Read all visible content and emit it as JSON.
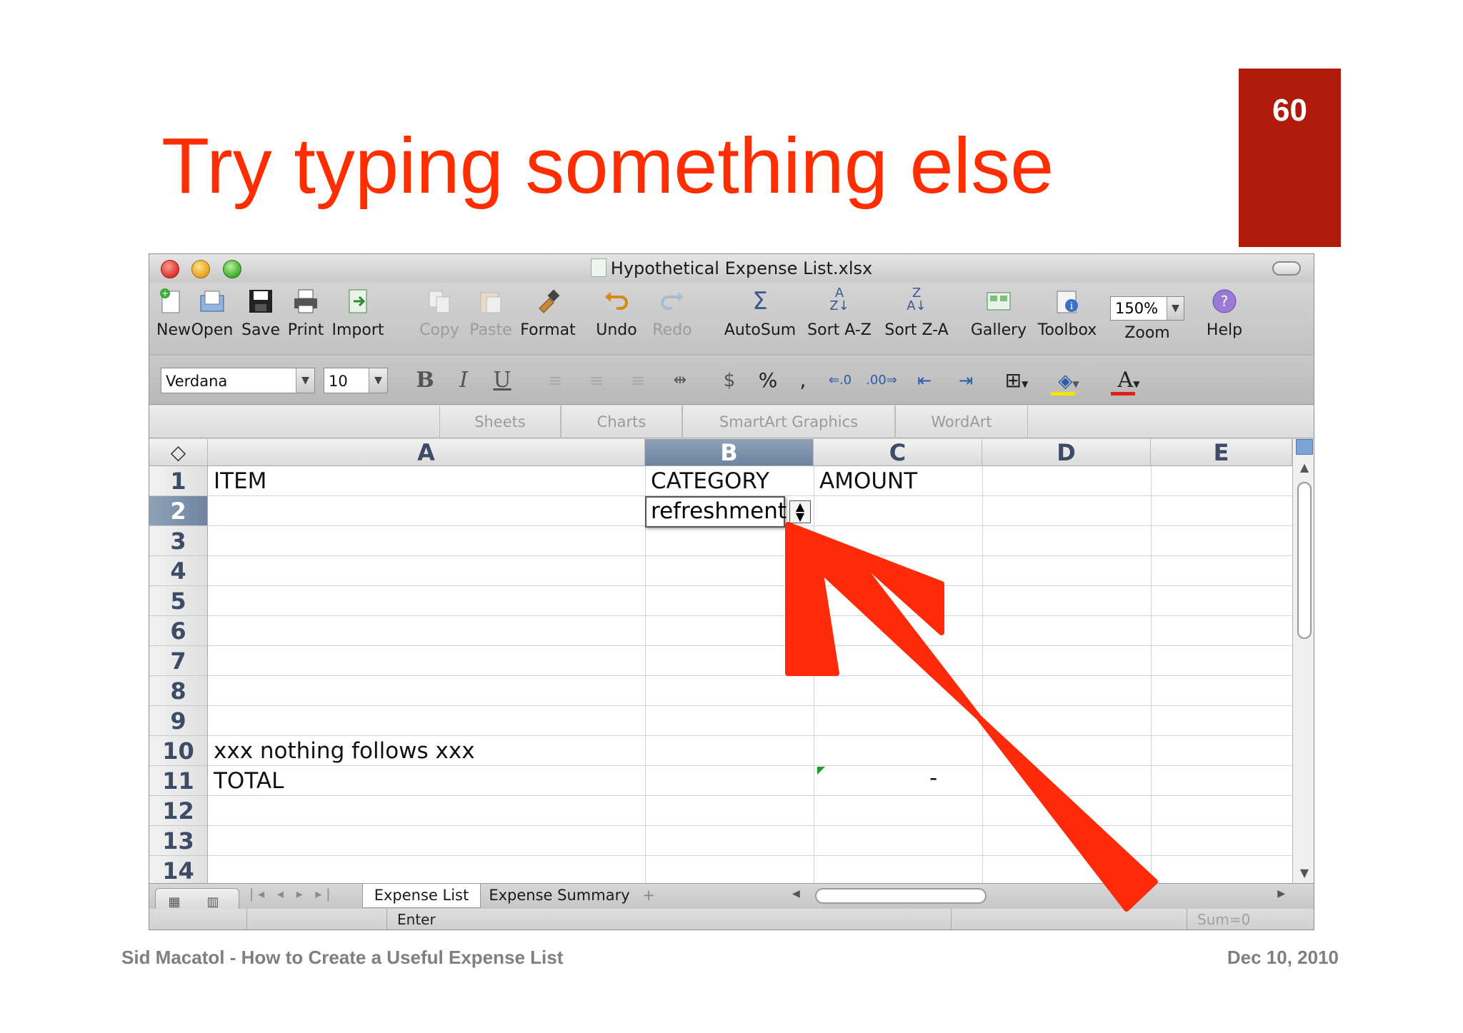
{
  "slide": {
    "title": "Try typing something else",
    "page_number": "60",
    "footer_left": "Sid Macatol - How to Create a Useful Expense List",
    "footer_right": "Dec 10, 2010",
    "accent_color": "#ff2d00",
    "badge_color": "#b01a0a"
  },
  "window": {
    "title": "Hypothetical Expense List.xlsx"
  },
  "toolbar": {
    "items": [
      {
        "label": "New",
        "icon": "new-document-icon"
      },
      {
        "label": "Open",
        "icon": "open-folder-icon"
      },
      {
        "label": "Save",
        "icon": "floppy-save-icon"
      },
      {
        "label": "Print",
        "icon": "printer-icon"
      },
      {
        "label": "Import",
        "icon": "import-icon"
      },
      {
        "label": "Copy",
        "icon": "copy-icon",
        "disabled": true
      },
      {
        "label": "Paste",
        "icon": "paste-icon",
        "disabled": true
      },
      {
        "label": "Format",
        "icon": "format-brush-icon"
      },
      {
        "label": "Undo",
        "icon": "undo-icon"
      },
      {
        "label": "Redo",
        "icon": "redo-icon",
        "disabled": true
      },
      {
        "label": "AutoSum",
        "icon": "sigma-icon"
      },
      {
        "label": "Sort A-Z",
        "icon": "sort-ascending-icon"
      },
      {
        "label": "Sort Z-A",
        "icon": "sort-descending-icon"
      },
      {
        "label": "Gallery",
        "icon": "gallery-icon"
      },
      {
        "label": "Toolbox",
        "icon": "toolbox-icon"
      },
      {
        "label": "Zoom",
        "icon": "zoom-icon"
      },
      {
        "label": "Help",
        "icon": "help-icon"
      }
    ],
    "zoom_value": "150%"
  },
  "format_bar": {
    "font_name": "Verdana",
    "font_size": "10",
    "bold": "B",
    "italic": "I",
    "underline": "U",
    "percent": "%",
    "comma": ",",
    "text_color_letter": "A",
    "fill_color": "#f5e600",
    "font_color": "#e0201a"
  },
  "ribbon": {
    "tabs": [
      "Sheets",
      "Charts",
      "SmartArt Graphics",
      "WordArt"
    ]
  },
  "sheet": {
    "columns": [
      "A",
      "B",
      "C",
      "D",
      "E"
    ],
    "selected_column": "B",
    "selected_row": "2",
    "rows": [
      "1",
      "2",
      "3",
      "4",
      "5",
      "6",
      "7",
      "8",
      "9",
      "10",
      "11",
      "12",
      "13",
      "14"
    ],
    "cells": {
      "A1": "ITEM",
      "B1": "CATEGORY",
      "C1": "AMOUNT",
      "A10": "xxx nothing follows xxx",
      "A11": "TOTAL",
      "C11": "-"
    },
    "editing_value": "refreshment"
  },
  "tabs": {
    "sheets": [
      "Expense List",
      "Expense Summary"
    ],
    "active": "Expense List",
    "add_symbol": "+"
  },
  "status": {
    "mode": "Enter",
    "sum": "Sum=0"
  }
}
